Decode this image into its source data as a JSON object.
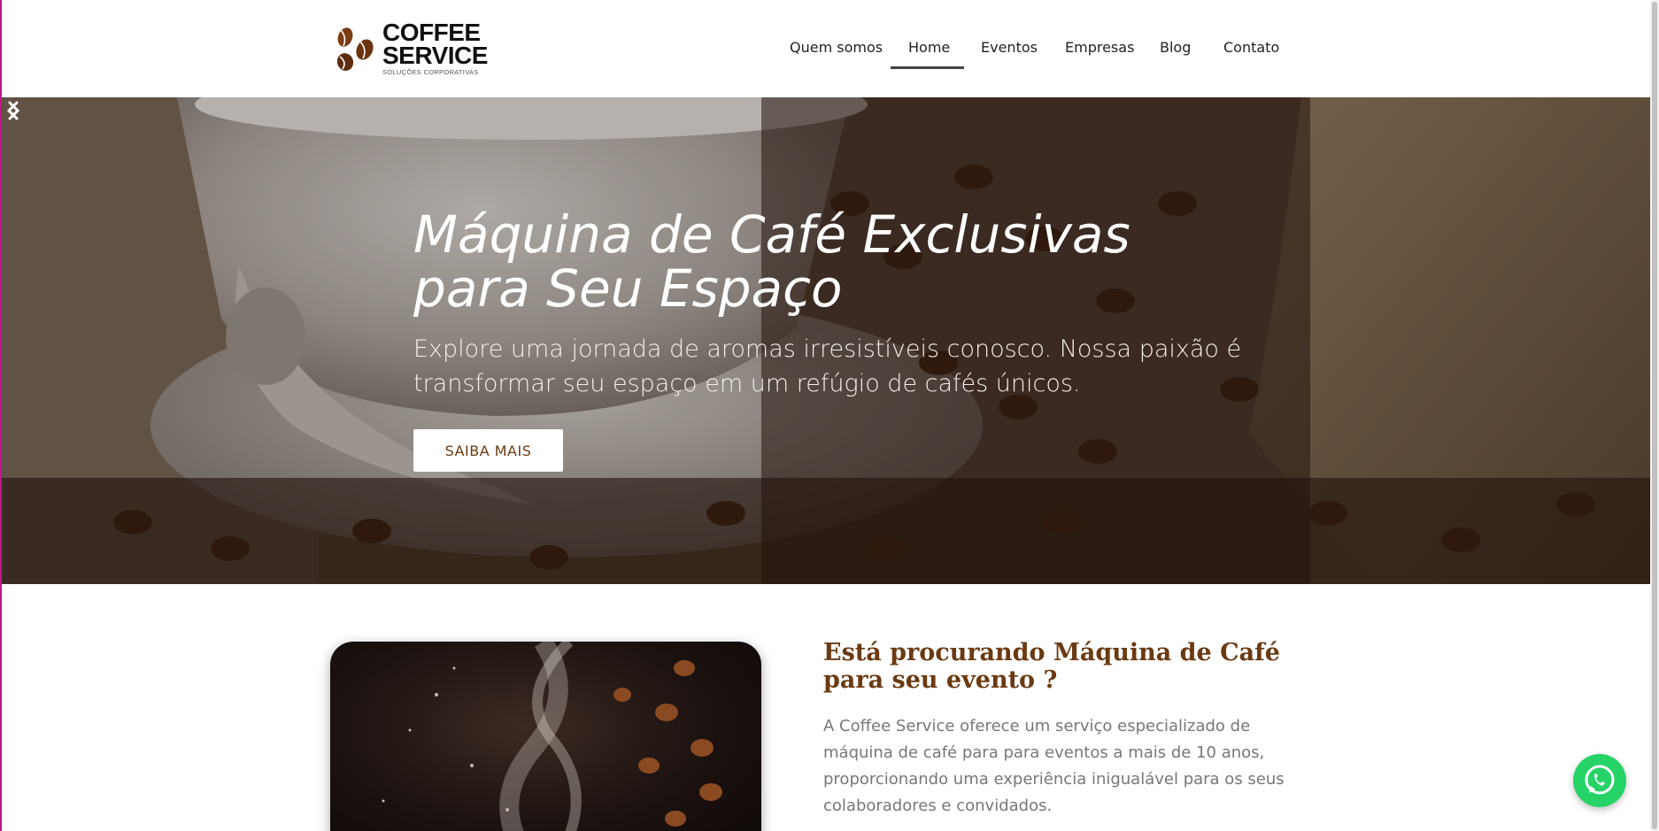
{
  "brand": {
    "line1": "COFFEE",
    "line2": "SERVICE",
    "tagline": "SOLUÇÕES CORPORATIVAS",
    "color_accent": "#6b3a12"
  },
  "nav": {
    "items": [
      {
        "label": "Quem somos",
        "active": false
      },
      {
        "label": "Home",
        "active": true
      },
      {
        "label": "Eventos",
        "active": false
      },
      {
        "label": "Empresas",
        "active": false
      },
      {
        "label": "Blog",
        "active": false
      },
      {
        "label": "Contato",
        "active": false
      }
    ]
  },
  "hero": {
    "title_line1": "Máquina de Café Exclusivas",
    "title_line2": "para Seu Espaço",
    "text_line1": "Explore uma jornada de aromas irresistíveis conosco. Nossa paixão é",
    "text_line2": "transformar seu espaço em um refúgio de cafés únicos.",
    "button_label": "SAIBA MAIS",
    "prev_icon": "chevron-left-icon",
    "next_icon": "chevron-right-icon"
  },
  "section": {
    "title_line1": "Está procurando Máquina de Café",
    "title_line2": "para seu evento ?",
    "text": "A Coffee Service oferece um serviço especializado de máquina de café para para eventos a mais de 10 anos, proporcionando uma experiência inigualável para os seus colaboradores e convidados."
  },
  "widgets": {
    "whatsapp_icon": "whatsapp-icon",
    "whatsapp_color": "#25d366"
  }
}
